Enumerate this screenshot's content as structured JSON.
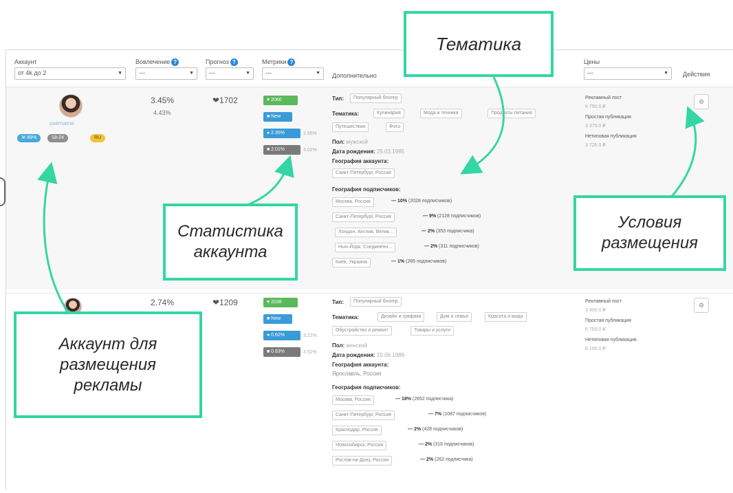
{
  "header": {
    "account_label": "Аккаунт",
    "account_value": "от 4k до 2",
    "engagement_label": "Вовлечение",
    "engagement_value": "---",
    "forecast_label": "Прогноз",
    "forecast_value": "---",
    "metrics_label": "Метрики",
    "metrics_value": "---",
    "extra_label": "Дополнительно",
    "prices_label": "Цены",
    "prices_value": "---",
    "actions_label": "Действия"
  },
  "rows": [
    {
      "username": "username",
      "tags": [
        "Ж 89%",
        "18-24",
        "RU"
      ],
      "engagement": "3.45%",
      "engagement2": "4.43%",
      "likes": "❤1702",
      "metrics": [
        {
          "label": "♥ 2060",
          "color": "green",
          "note": ""
        },
        {
          "label": "■ New",
          "color": "blue",
          "note": ""
        },
        {
          "label": "● 2.35%",
          "color": "blue",
          "note": "2.65%"
        },
        {
          "label": "■ 2.01%",
          "color": "grey",
          "note": "3.02%"
        }
      ],
      "type_label": "Тип:",
      "type_value": "Популярный блогер",
      "topics_label": "Тематика:",
      "topics": [
        "Кулинария",
        "Мода и техника",
        "Продукты питания",
        "Путешествия",
        "Фото"
      ],
      "gender_label": "Пол:",
      "gender_value": "мужской",
      "birth_label": "Дата рождения:",
      "birth_value": "25.03.1985",
      "geo_label": "География аккаунта:",
      "geo_value": "Санкт-Петербург, Россия",
      "subgeo_label": "География подписчиков:",
      "subgeo": [
        {
          "city": "Москва, Россия",
          "pct": "— 10%",
          "count": "(2028 подписчиков)"
        },
        {
          "city": "Санкт-Петербург, Россия",
          "pct": "— 9%",
          "count": "(2128 подписчиков)"
        },
        {
          "city": "Лондон, Англия, Велик...",
          "pct": "— 2%",
          "count": "(353 подписчика)"
        },
        {
          "city": "Нью-Йорк, Соединённ...",
          "pct": "— 2%",
          "count": "(311 подписчиков)"
        },
        {
          "city": "Киев, Украина",
          "pct": "— 1%",
          "count": "(285 подписчиков)"
        }
      ],
      "prices": [
        {
          "label": "Рекламный пост",
          "value": "6 750.0 ₽"
        },
        {
          "label": "Простая публикация",
          "value": "3 375.0 ₽"
        },
        {
          "label": "Нетиповая публикация",
          "value": "3 725.0 ₽"
        }
      ],
      "action_icon": "gear-icon"
    },
    {
      "username": "",
      "tags": [],
      "engagement": "2.74%",
      "engagement2": "",
      "likes": "❤1209",
      "metrics": [
        {
          "label": "♥ 2038",
          "color": "green",
          "note": ""
        },
        {
          "label": "■ New",
          "color": "blue",
          "note": ""
        },
        {
          "label": "● 0.62%",
          "color": "blue",
          "note": "3.22%"
        },
        {
          "label": "■ 0.63%",
          "color": "grey",
          "note": "3.52%"
        }
      ],
      "type_label": "Тип:",
      "type_value": "Популярный блогер",
      "topics_label": "Тематика:",
      "topics": [
        "Дизайн и графика",
        "Дом и семья",
        "Красота и мода",
        "Обустройство и ремонт",
        "Товары и услуги"
      ],
      "gender_label": "Пол:",
      "gender_value": "женский",
      "birth_label": "Дата рождения:",
      "birth_value": "15.06.1989",
      "geo_label": "География аккаунта:",
      "geo_value": "Ярославль, Россия",
      "subgeo_label": "География подписчиков:",
      "subgeo": [
        {
          "city": "Москва, Россия",
          "pct": "— 18%",
          "count": "(2652 подписчика)"
        },
        {
          "city": "Санкт-Петербург, Россия",
          "pct": "— 7%",
          "count": "(1087 подписчиков)"
        },
        {
          "city": "Краснодар, Россия",
          "pct": "— 2%",
          "count": "(428 подписчиков)"
        },
        {
          "city": "Новосибирск, Россия",
          "pct": "— 2%",
          "count": "(316 подписчиков)"
        },
        {
          "city": "Ростов-на-Дону, Россия",
          "pct": "— 2%",
          "count": "(262 подписчика)"
        }
      ],
      "prices": [
        {
          "label": "Рекламный пост",
          "value": "3 400.0 ₽"
        },
        {
          "label": "Простая публикация",
          "value": "6 750.0 ₽"
        },
        {
          "label": "Нетиповая публикация",
          "value": "8 100.0 ₽"
        }
      ],
      "action_icon": "gear-icon"
    }
  ],
  "callouts": {
    "topic": "Тематика",
    "stats": "Статистика аккаунта",
    "conditions": "Условия размещения",
    "account": "Аккаунт для размещения рекламы"
  },
  "accent_color": "#34d6a3"
}
